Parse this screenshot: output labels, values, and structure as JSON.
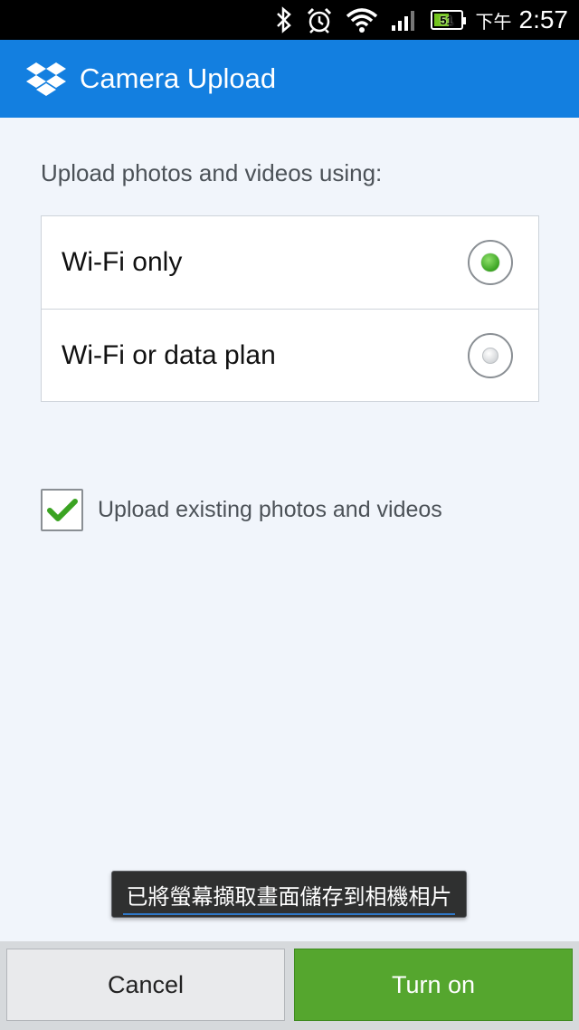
{
  "status_bar": {
    "icons": [
      "bluetooth-icon",
      "alarm-icon",
      "wifi-icon",
      "signal-icon",
      "battery-icon"
    ],
    "battery_level": "51",
    "ampm": "下午",
    "time": "2:57"
  },
  "app_bar": {
    "logo": "dropbox-logo",
    "title": "Camera Upload"
  },
  "settings": {
    "prompt": "Upload photos and videos using:",
    "options": [
      {
        "label": "Wi-Fi only",
        "selected": true
      },
      {
        "label": "Wi-Fi or data plan",
        "selected": false
      }
    ],
    "upload_existing": {
      "label": "Upload existing photos and videos",
      "checked": true
    }
  },
  "toast": {
    "text": "已將螢幕擷取畫面儲存到相機相片"
  },
  "buttons": {
    "cancel": "Cancel",
    "turn_on": "Turn on"
  },
  "colors": {
    "accent": "#137fe0",
    "primary_button": "#55a62e",
    "check": "#3aa322"
  }
}
